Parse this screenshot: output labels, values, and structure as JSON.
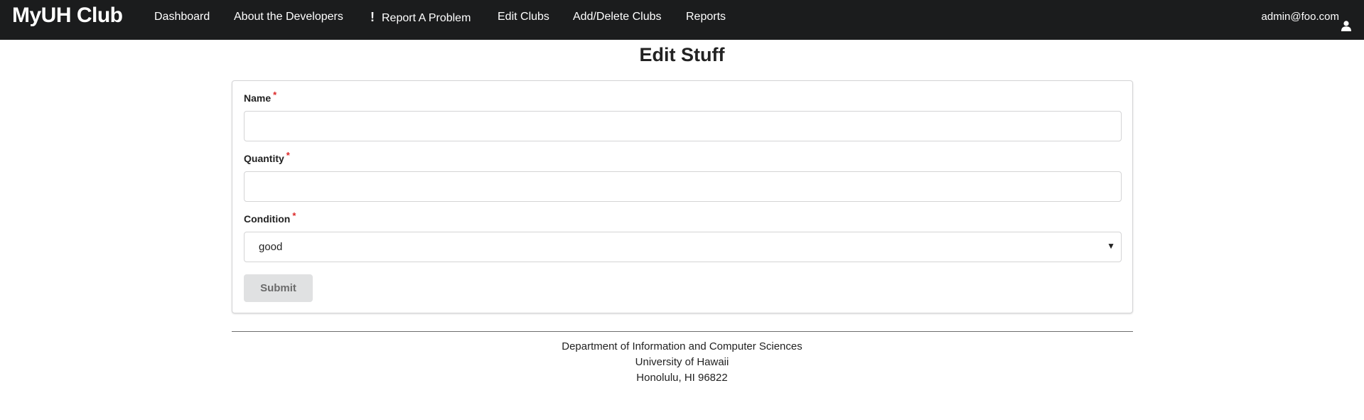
{
  "navbar": {
    "brand": "MyUH Club",
    "items": [
      {
        "label": "Dashboard"
      },
      {
        "label": "About the Developers"
      },
      {
        "icon": "exclamation-icon",
        "label": "Report A Problem"
      },
      {
        "label": "Edit Clubs"
      },
      {
        "label": "Add/Delete Clubs"
      },
      {
        "label": "Reports"
      }
    ],
    "user": {
      "email": "admin@foo.com",
      "icon": "user-icon"
    }
  },
  "page": {
    "title": "Edit Stuff"
  },
  "form": {
    "fields": {
      "name": {
        "label": "Name",
        "required_mark": "*",
        "value": ""
      },
      "quantity": {
        "label": "Quantity",
        "required_mark": "*",
        "value": ""
      },
      "condition": {
        "label": "Condition",
        "required_mark": "*",
        "value": "good"
      }
    },
    "submit_label": "Submit"
  },
  "footer": {
    "lines": [
      "Department of Information and Computer Sciences",
      "University of Hawaii",
      "Honolulu, HI 96822"
    ]
  },
  "colors": {
    "navbar_bg": "#1b1c1d",
    "required": "#db2828",
    "button_bg": "#e0e1e2"
  }
}
